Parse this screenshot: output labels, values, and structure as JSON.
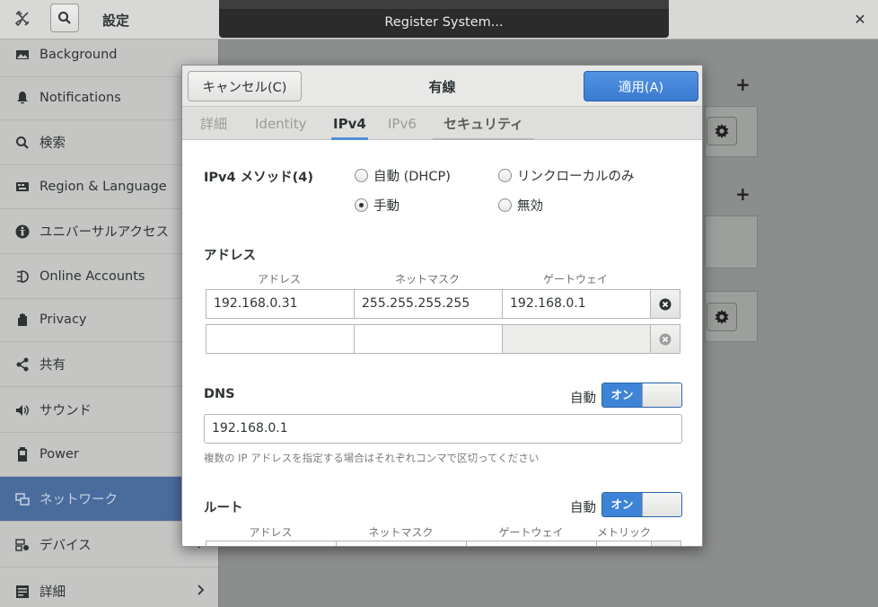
{
  "header": {
    "title": "設定",
    "close": "✕"
  },
  "banner": {
    "text": "Register System..."
  },
  "sidebar": {
    "items": [
      {
        "label": "Background",
        "icon": "background-icon"
      },
      {
        "label": "Notifications",
        "icon": "notifications-icon"
      },
      {
        "label": "検索",
        "icon": "search-icon"
      },
      {
        "label": "Region & Language",
        "icon": "region-icon"
      },
      {
        "label": "ユニバーサルアクセス",
        "icon": "accessibility-icon"
      },
      {
        "label": "Online Accounts",
        "icon": "online-accounts-icon"
      },
      {
        "label": "Privacy",
        "icon": "privacy-icon"
      },
      {
        "label": "共有",
        "icon": "share-icon"
      },
      {
        "label": "サウンド",
        "icon": "sound-icon"
      },
      {
        "label": "Power",
        "icon": "power-icon"
      },
      {
        "label": "ネットワーク",
        "icon": "network-icon",
        "active": true
      },
      {
        "label": "デバイス",
        "icon": "devices-icon"
      },
      {
        "label": "詳細",
        "icon": "details-icon"
      }
    ]
  },
  "dialog": {
    "title": "有線",
    "cancel_label": "キャンセル(C)",
    "apply_label": "適用(A)",
    "tabs": [
      "詳細",
      "Identity",
      "IPv4",
      "IPv6",
      "セキュリティ"
    ],
    "active_tab": "IPv4",
    "ipv4": {
      "method_label": "IPv4 メソッド(4)",
      "methods": [
        {
          "label": "自動 (DHCP)",
          "selected": false
        },
        {
          "label": "リンクローカルのみ",
          "selected": false
        },
        {
          "label": "手動",
          "selected": true
        },
        {
          "label": "無効",
          "selected": false
        }
      ],
      "address_section": "アドレス",
      "address_columns": [
        "アドレス",
        "ネットマスク",
        "ゲートウェイ"
      ],
      "addresses": [
        {
          "address": "192.168.0.31",
          "netmask": "255.255.255.255",
          "gateway": "192.168.0.1"
        },
        {
          "address": "",
          "netmask": "",
          "gateway": ""
        }
      ],
      "dns_label": "DNS",
      "auto_label": "自動",
      "switch_on": "オン",
      "dns_value": "192.168.0.1",
      "dns_hint": "複数の IP アドレスを指定する場合はそれぞれコンマで区切ってください",
      "route_label": "ルート",
      "route_columns": [
        "アドレス",
        "ネットマスク",
        "ゲートウェイ",
        "メトリック"
      ]
    }
  },
  "colors": {
    "accent": "#3d84d6",
    "sidebar_active": "#4a6c9d"
  }
}
